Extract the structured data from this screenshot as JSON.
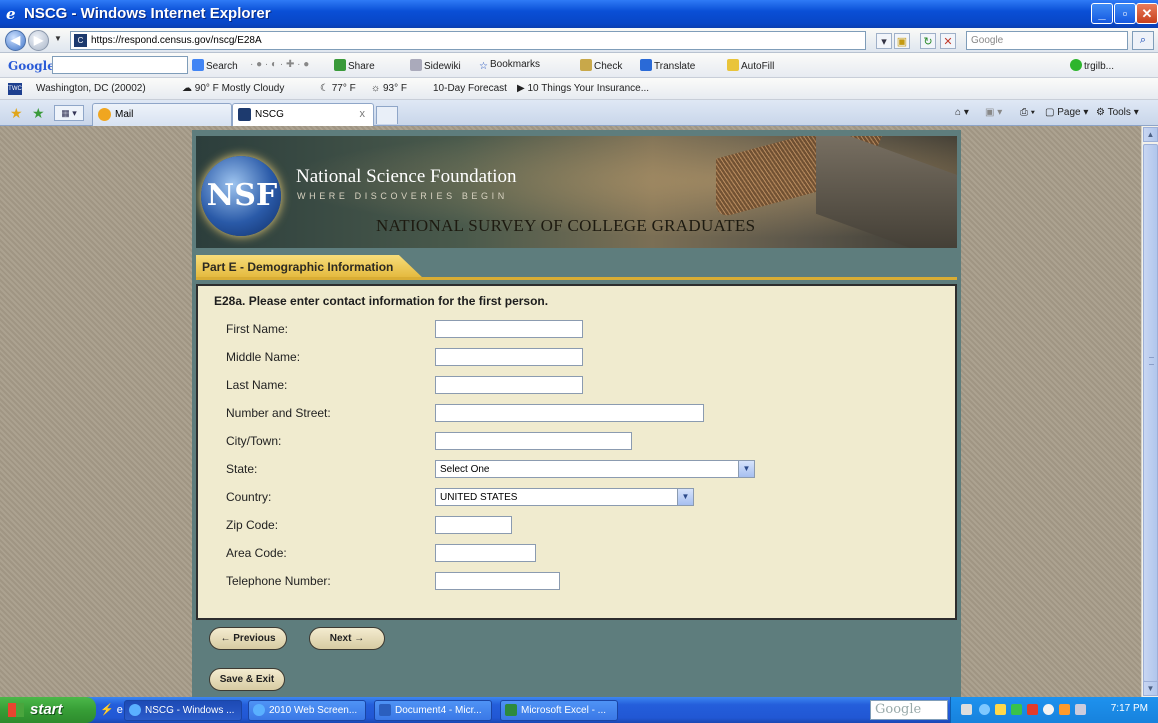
{
  "window": {
    "title": "NSCG - Windows Internet Explorer",
    "controls": [
      "_",
      "▫",
      "✕"
    ]
  },
  "address_bar": {
    "url": "https://respond.census.gov/nscg/E28A",
    "search_placeholder": "Google"
  },
  "google_toolbar": {
    "logo": "Google",
    "items": [
      "Search",
      "Share",
      "Sidewiki",
      "Bookmarks",
      "Check",
      "Translate",
      "AutoFill"
    ],
    "user": "trgilb..."
  },
  "links_bar": {
    "location": "Washington, DC (20002)",
    "weather_now": "90° F Mostly Cloudy",
    "temp_low": "77° F",
    "temp_high": "93° F",
    "forecast": "10-Day Forecast",
    "news": "10 Things Your Insurance..."
  },
  "tabs": {
    "mail_label": "Mail",
    "active_label": "NSCG",
    "close": "x"
  },
  "command_bar": {
    "page": "Page",
    "tools": "Tools"
  },
  "banner": {
    "logo_text": "NSF",
    "org_name": "National Science Foundation",
    "tagline": "WHERE DISCOVERIES BEGIN",
    "survey": "NATIONAL SURVEY OF COLLEGE GRADUATES"
  },
  "section": {
    "title": "Part E - Demographic Information"
  },
  "form": {
    "question": "E28a. Please enter contact information for the first person.",
    "fields": [
      {
        "label": "First Name:",
        "value": ""
      },
      {
        "label": "Middle Name:",
        "value": ""
      },
      {
        "label": "Last Name:",
        "value": ""
      },
      {
        "label": "Number and Street:",
        "value": ""
      },
      {
        "label": "City/Town:",
        "value": ""
      },
      {
        "label": "State:",
        "value": "Select One"
      },
      {
        "label": "Country:",
        "value": "UNITED STATES"
      },
      {
        "label": "Zip Code:",
        "value": ""
      },
      {
        "label": "Area Code:",
        "value": ""
      },
      {
        "label": "Telephone Number:",
        "value": ""
      }
    ]
  },
  "buttons": {
    "previous": "← Previous",
    "next": "Next →",
    "save_exit": "Save & Exit"
  },
  "taskbar": {
    "start": "start",
    "items": [
      "NSCG - Windows ...",
      "2010 Web Screen...",
      "Document4 - Micr...",
      "Microsoft Excel - ..."
    ],
    "deskbar": "Google",
    "clock": "7:17 PM"
  }
}
